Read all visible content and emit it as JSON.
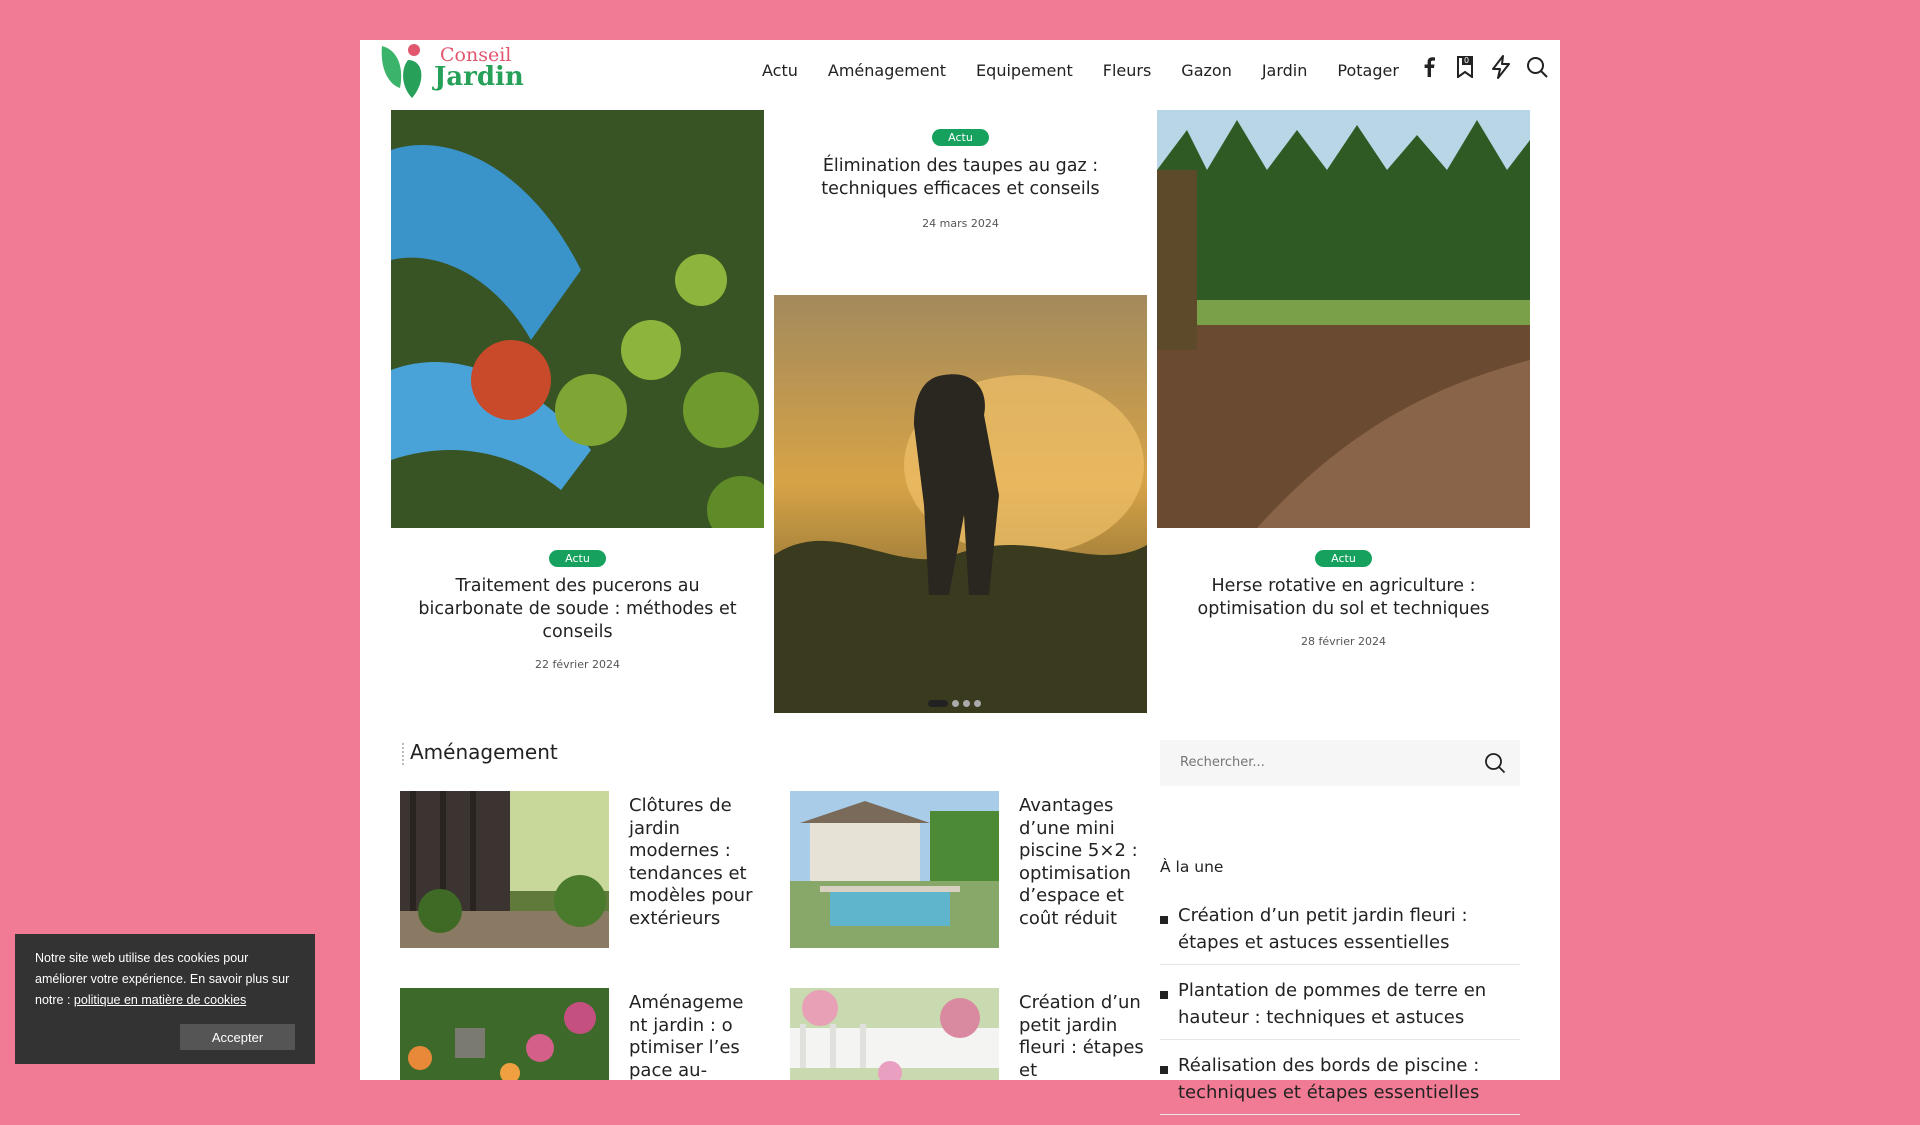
{
  "site": {
    "logo_line1": "Conseil",
    "logo_line2": "Jardin"
  },
  "nav": {
    "items": [
      "Actu",
      "Aménagement",
      "Equipement",
      "Fleurs",
      "Gazon",
      "Jardin",
      "Potager"
    ]
  },
  "icons": {
    "facebook": "facebook-icon",
    "bookmark": "bookmark-icon",
    "bookmark_count": "0",
    "flash": "lightning-icon",
    "search": "search-icon"
  },
  "slider": {
    "cards": [
      {
        "badge": "Actu",
        "title": "Traitement des pucerons au bicarbonate de soude : méthodes et conseils",
        "date": "22 février 2024"
      },
      {
        "badge": "Actu",
        "title": "Élimination des taupes au gaz : techniques efficaces et conseils",
        "date": "24 mars 2024"
      },
      {
        "badge": "Actu",
        "title": "Herse rotative en agriculture : optimisation du sol et techniques",
        "date": "28 février 2024"
      }
    ],
    "active_slide": 1,
    "total_slides": 4
  },
  "section": {
    "title": "Aménagement",
    "posts": [
      {
        "title": "Clôtures de jardin modernes : tendances et modèles pour extérieurs"
      },
      {
        "title": "Avantages d’une mini piscine 5×2 : optimisation d’espace et coût réduit"
      },
      {
        "title": "Aménagement jardin : optimiser l’espace au-"
      },
      {
        "title": "Création d’un petit jardin fleuri : étapes et"
      }
    ]
  },
  "sidebar": {
    "search_placeholder": "Rechercher...",
    "une_title": "À la une",
    "une_items": [
      "Création d’un petit jardin fleuri : étapes et astuces essentielles",
      "Plantation de pommes de terre en hauteur : techniques et astuces",
      "Réalisation des bords de piscine : techniques et étapes essentielles"
    ]
  },
  "cookie": {
    "text": "Notre site web utilise des cookies pour améliorer votre expérience. En savoir plus sur notre :",
    "link": "politique en matière de cookies",
    "accept": "Accepter"
  },
  "colors": {
    "background": "#f17b94",
    "badge": "#16a25e",
    "logo_red": "#e0576f",
    "logo_green": "#27a05a"
  }
}
